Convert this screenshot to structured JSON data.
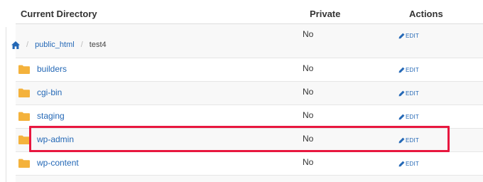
{
  "table": {
    "headers": {
      "directory": "Current Directory",
      "private": "Private",
      "actions": "Actions"
    },
    "breadcrumb": {
      "home_icon": "home-icon",
      "separator": "/",
      "items": [
        "public_html",
        "test4"
      ],
      "private": "No",
      "edit": "EDIT"
    },
    "rows": [
      {
        "name": "builders",
        "private": "No",
        "edit": "EDIT"
      },
      {
        "name": "cgi-bin",
        "private": "No",
        "edit": "EDIT"
      },
      {
        "name": "staging",
        "private": "No",
        "edit": "EDIT"
      },
      {
        "name": "wp-admin",
        "private": "No",
        "edit": "EDIT"
      },
      {
        "name": "wp-content",
        "private": "No",
        "edit": "EDIT"
      }
    ]
  },
  "colors": {
    "link": "#2468b6",
    "folder": "#f4b23c",
    "highlight": "#e8173f"
  },
  "highlighted_row": "wp-admin"
}
